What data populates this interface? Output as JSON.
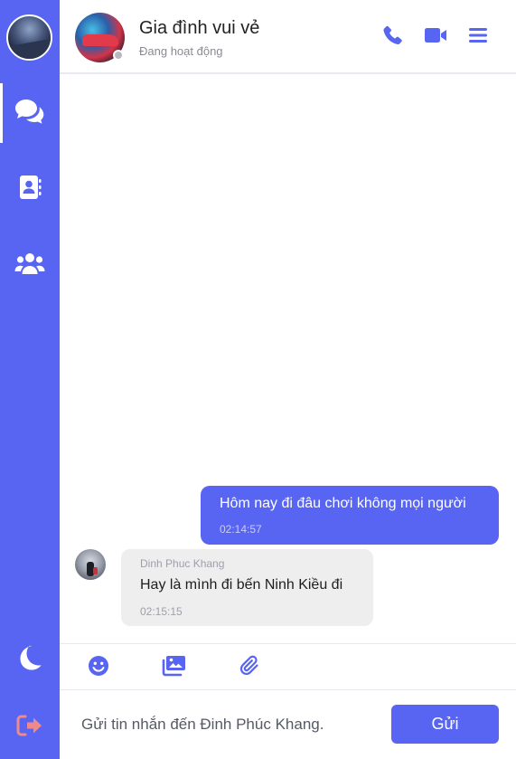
{
  "sidebar": {
    "items": [
      {
        "name": "messages",
        "icon": "chat-bubbles-icon",
        "active": true
      },
      {
        "name": "contacts",
        "icon": "contact-book-icon",
        "active": false
      },
      {
        "name": "groups",
        "icon": "users-group-icon",
        "active": false
      }
    ],
    "bottom": [
      {
        "name": "theme",
        "icon": "moon-icon"
      },
      {
        "name": "logout",
        "icon": "sign-out-icon",
        "color": "#f08a8a"
      }
    ]
  },
  "header": {
    "title": "Gia đình vui vẻ",
    "status": "Đang hoạt động",
    "actions": [
      "phone-icon",
      "video-icon",
      "menu-icon"
    ]
  },
  "messages": [
    {
      "direction": "outgoing",
      "text": "Hôm nay đi đâu chơi không mọi người",
      "time": "02:14:57"
    },
    {
      "direction": "incoming",
      "sender": "Dinh Phuc Khang",
      "text": "Hay là mình đi bến Ninh Kiều đi",
      "time": "02:15:15"
    }
  ],
  "toolbar": {
    "tools": [
      "emoji-icon",
      "images-icon",
      "paperclip-icon"
    ]
  },
  "composer": {
    "placeholder": "Gửi tin nhắn đến Đinh Phúc Khang.",
    "value": "",
    "send_label": "Gửi"
  },
  "colors": {
    "accent": "#5865f2",
    "incoming_bubble": "#eeeeef",
    "logout": "#f08a8a",
    "status_offline": "#b8b8c0"
  }
}
